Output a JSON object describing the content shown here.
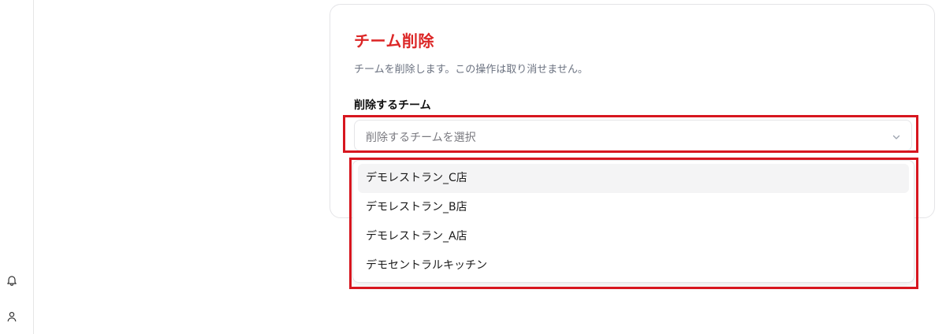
{
  "colors": {
    "title": "#dc2626",
    "highlight": "#d7161f",
    "muted_text": "#6b7280",
    "active_option_bg": "#f4f4f5"
  },
  "sidebar": {
    "icons": [
      "bell-icon",
      "user-icon"
    ]
  },
  "delete_team": {
    "title": "チーム削除",
    "description": "チームを削除します。この操作は取り消せません。",
    "field_label": "削除するチーム",
    "select": {
      "placeholder": "削除するチームを選択",
      "icon": "chevron-down-icon"
    },
    "options": [
      {
        "label": "デモレストラン_C店",
        "active": true
      },
      {
        "label": "デモレストラン_B店",
        "active": false
      },
      {
        "label": "デモレストラン_A店",
        "active": false
      },
      {
        "label": "デモセントラルキッチン",
        "active": false
      }
    ]
  }
}
